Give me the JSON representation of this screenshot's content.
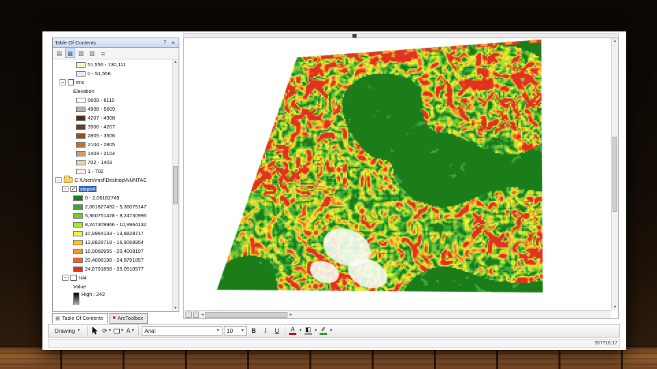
{
  "icons": {
    "check": "✓",
    "collapse": "−",
    "dropdown": "▼",
    "up": "▲",
    "down": "▼",
    "left": "◄",
    "right": "►"
  },
  "toc": {
    "title": "Table Of Contents",
    "help_icon": "?",
    "close_icon": "✕",
    "toolbar_icons": [
      {
        "name": "list-by-drawing-order-icon",
        "glyph": "▤",
        "pressed": false
      },
      {
        "name": "list-by-source-icon",
        "glyph": "▦",
        "pressed": true
      },
      {
        "name": "list-by-visibility-icon",
        "glyph": "▧",
        "pressed": false
      },
      {
        "name": "list-by-selection-icon",
        "glyph": "▥",
        "pressed": false
      },
      {
        "name": "options-icon",
        "glyph": "≣",
        "pressed": false
      }
    ],
    "partial_rows": [
      {
        "color": "#f5f2c2",
        "label": "51,556 - 130,111"
      },
      {
        "color": "#d8f0f2",
        "label": "0 - 51,556"
      }
    ],
    "tms": {
      "name": "tms",
      "field": "Elevation",
      "classes": [
        {
          "color": "#fdfdfd",
          "label": "5609 - 6110"
        },
        {
          "color": "#b8b2ac",
          "label": "4908 - 5609"
        },
        {
          "color": "#4f2c16",
          "label": "4207 - 4908"
        },
        {
          "color": "#713a1c",
          "label": "3506 - 4207"
        },
        {
          "color": "#96501f",
          "label": "2805 - 3506"
        },
        {
          "color": "#b4733c",
          "label": "2104 - 2805"
        },
        {
          "color": "#d29e74",
          "label": "1403 - 2104"
        },
        {
          "color": "#ecd0b0",
          "label": "702 - 1403"
        },
        {
          "color": "#f8efe2",
          "label": "1 - 702"
        }
      ]
    },
    "group_path": "C:\\Users\\msf\\Desktop\\NUNTAC",
    "slope_layer": {
      "name": "slope4",
      "classes": [
        {
          "color": "#1a7d1a",
          "label": "0 - 2,06182749"
        },
        {
          "color": "#39a639",
          "label": "2,061827492 - 5,36075147"
        },
        {
          "color": "#7dc432",
          "label": "5,360751478 - 8,24730996"
        },
        {
          "color": "#b4dc32",
          "label": "8,247309966 - 10,9964132"
        },
        {
          "color": "#f0f032",
          "label": "10,9964133 - 13,8828717"
        },
        {
          "color": "#f0c832",
          "label": "13,8828718 - 16,9068954"
        },
        {
          "color": "#f09632",
          "label": "16,9068955 - 20,4008197"
        },
        {
          "color": "#ed6428",
          "label": "20,4008198 - 24,8791857"
        },
        {
          "color": "#e03220",
          "label": "24,8791858 - 35,0510577"
        }
      ]
    },
    "hill_layer": {
      "name": "hil4",
      "field": "Value",
      "high_label": "High : 242"
    }
  },
  "tabs": {
    "toc_label": "Table Of Contents",
    "toc_icon": "▦",
    "toolbox_label": "ArcToolbox",
    "toolbox_icon": "■"
  },
  "drawing": {
    "label": "Drawing",
    "text_tool": "A",
    "font": "Arial",
    "size": "10",
    "bold": "B",
    "italic": "I",
    "underline": "U",
    "font_color_letter": "A",
    "font_color": "#cc0000",
    "fill_color": "#8899aa",
    "line_color": "#2aa02a"
  },
  "status": {
    "coords": "557716.17"
  },
  "map": {
    "background": "#ffffff"
  }
}
